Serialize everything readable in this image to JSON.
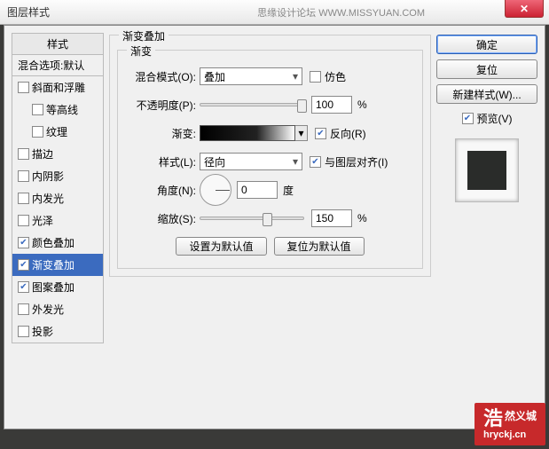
{
  "window": {
    "title": "图层样式",
    "subtitle": "思缘设计论坛 WWW.MISSYUAN.COM"
  },
  "buttons": {
    "ok": "确定",
    "reset": "复位",
    "newstyle": "新建样式(W)...",
    "preview": "预览(V)",
    "set_default": "设置为默认值",
    "reset_default": "复位为默认值"
  },
  "left": {
    "header": "样式",
    "sub": "混合选项:默认",
    "items": [
      {
        "label": "斜面和浮雕",
        "checked": false,
        "indent": false
      },
      {
        "label": "等高线",
        "checked": false,
        "indent": true
      },
      {
        "label": "纹理",
        "checked": false,
        "indent": true
      },
      {
        "label": "描边",
        "checked": false,
        "indent": false
      },
      {
        "label": "内阴影",
        "checked": false,
        "indent": false
      },
      {
        "label": "内发光",
        "checked": false,
        "indent": false
      },
      {
        "label": "光泽",
        "checked": false,
        "indent": false
      },
      {
        "label": "颜色叠加",
        "checked": true,
        "indent": false
      },
      {
        "label": "渐变叠加",
        "checked": true,
        "indent": false,
        "selected": true
      },
      {
        "label": "图案叠加",
        "checked": true,
        "indent": false
      },
      {
        "label": "外发光",
        "checked": false,
        "indent": false
      },
      {
        "label": "投影",
        "checked": false,
        "indent": false
      }
    ]
  },
  "panel": {
    "title": "渐变叠加",
    "subtitle": "渐变",
    "blend_label": "混合模式(O):",
    "blend_value": "叠加",
    "dither_label": "仿色",
    "opacity_label": "不透明度(P):",
    "opacity_value": "100",
    "pct": "%",
    "gradient_label": "渐变:",
    "reverse_label": "反向(R)",
    "style_label": "样式(L):",
    "style_value": "径向",
    "align_label": "与图层对齐(I)",
    "angle_label": "角度(N):",
    "angle_value": "0",
    "angle_unit": "度",
    "scale_label": "缩放(S):",
    "scale_value": "150"
  },
  "watermark": {
    "cn1": "浩",
    "cn2": "然义城",
    "url": "hryckj.cn"
  }
}
